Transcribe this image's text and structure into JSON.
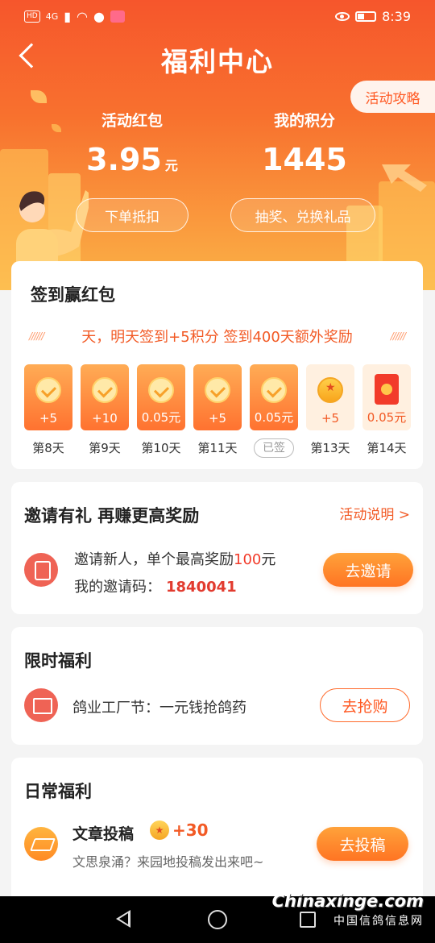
{
  "status_bar": {
    "network_chip": "HD",
    "signal": "4G",
    "time": "8:39"
  },
  "header": {
    "title": "福利中心",
    "guide_label": "活动攻略"
  },
  "stats": {
    "red_packet": {
      "label": "活动红包",
      "value": "3.95",
      "unit": "元",
      "button": "下单抵扣"
    },
    "points": {
      "label": "我的积分",
      "value": "1445",
      "button": "抽奖、兑换礼品"
    }
  },
  "signin": {
    "title": "签到赢红包",
    "ticker_dash": "//////",
    "ticker": "天，明天签到+5积分 签到400天额外奖励",
    "days": [
      {
        "reward": "+5",
        "label": "第8天",
        "state": "signed"
      },
      {
        "reward": "+10",
        "label": "第9天",
        "state": "signed"
      },
      {
        "reward": "0.05元",
        "label": "第10天",
        "state": "signed"
      },
      {
        "reward": "+5",
        "label": "第11天",
        "state": "signed"
      },
      {
        "reward": "0.05元",
        "label": "已签",
        "state": "today"
      },
      {
        "reward": "+5",
        "label": "第13天",
        "state": "future-coin"
      },
      {
        "reward": "0.05元",
        "label": "第14天",
        "state": "future-redpack"
      }
    ]
  },
  "invite": {
    "title": "邀请有礼  再赚更高奖励",
    "rule_link": "活动说明 >",
    "line1_prefix": "邀请新人，单个最高奖励",
    "line1_amount": "100",
    "line1_suffix": "元",
    "code_label": "我的邀请码：",
    "code": "1840041",
    "button": "去邀请"
  },
  "limited": {
    "title": "限时福利",
    "text": "鸽业工厂节：一元钱抢鸽药",
    "button": "去抢购"
  },
  "daily": {
    "title": "日常福利",
    "item_title": "文章投稿",
    "item_points": "+30",
    "item_sub": "文思泉涌？来园地投稿发出来吧~",
    "button": "去投稿"
  },
  "watermark": {
    "line1": "Chinaxinge.com",
    "line2": "中国信鸽信息网"
  },
  "colors": {
    "accent": "#f25a25",
    "header_top": "#f6562c",
    "header_bottom": "#fbb347"
  }
}
